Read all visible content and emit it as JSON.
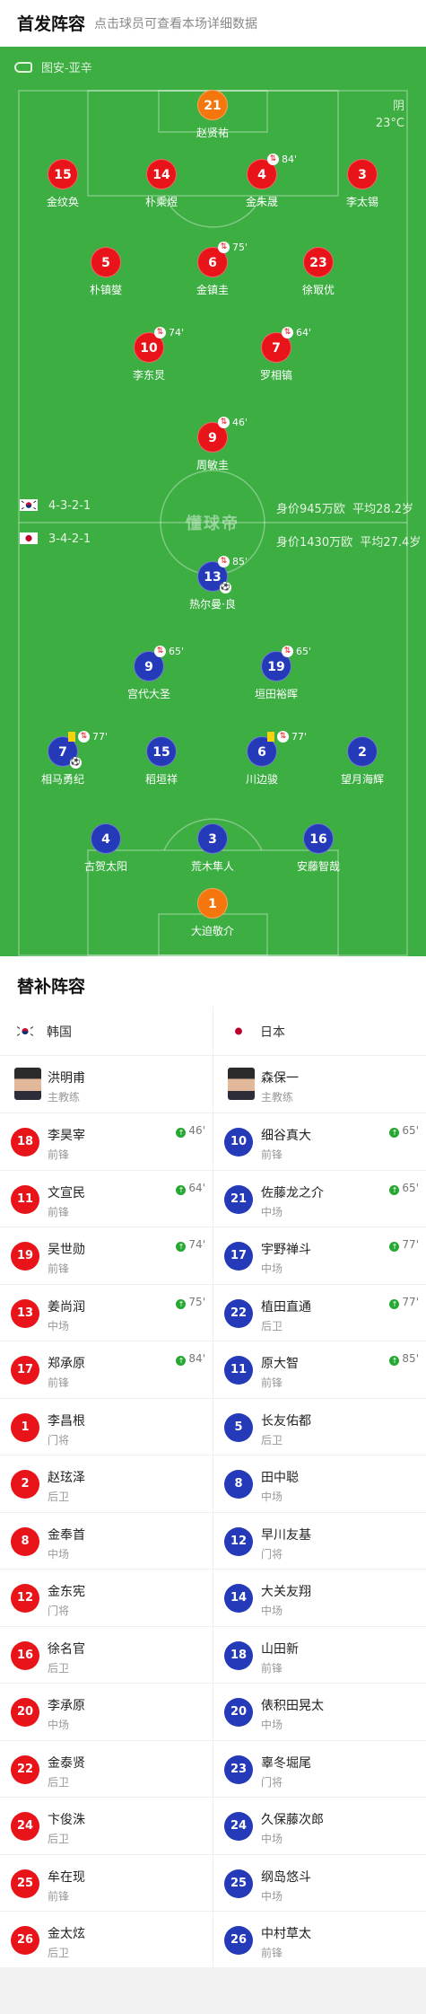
{
  "header": {
    "title": "首发阵容",
    "subtitle": "点击球员可查看本场详细数据"
  },
  "pitch": {
    "referee": "图安-亚辛",
    "weather": {
      "condition": "阴",
      "temperature": "23°C"
    },
    "watermark": "懂球帝",
    "home": {
      "formation": "4-3-2-1",
      "value": "身价945万欧",
      "avg_age": "平均28.2岁"
    },
    "away": {
      "formation": "3-4-2-1",
      "value": "身价1430万欧",
      "avg_age": "平均27.4岁"
    }
  },
  "home_players": [
    {
      "num": "21",
      "name": "赵贤祐",
      "gk": true
    },
    {
      "num": "15",
      "name": "金纹奂"
    },
    {
      "num": "14",
      "name": "朴乘煜"
    },
    {
      "num": "4",
      "name": "金朱晟",
      "sub": "84'"
    },
    {
      "num": "3",
      "name": "李太锡"
    },
    {
      "num": "5",
      "name": "朴镇燮"
    },
    {
      "num": "6",
      "name": "金镇圭",
      "sub": "75'"
    },
    {
      "num": "23",
      "name": "徐冣优"
    },
    {
      "num": "10",
      "name": "李东炅",
      "sub": "74'"
    },
    {
      "num": "7",
      "name": "罗相镐",
      "sub": "64'"
    },
    {
      "num": "9",
      "name": "周敏圭",
      "sub": "46'"
    }
  ],
  "away_players": [
    {
      "num": "13",
      "name": "热尔曼·良",
      "sub": "85'",
      "goal": true
    },
    {
      "num": "9",
      "name": "宫代大圣",
      "sub": "65'"
    },
    {
      "num": "19",
      "name": "垣田裕晖",
      "sub": "65'"
    },
    {
      "num": "7",
      "name": "相马勇纪",
      "sub": "77'",
      "yellow": true,
      "goal": true
    },
    {
      "num": "15",
      "name": "稻垣祥"
    },
    {
      "num": "6",
      "name": "川边骏",
      "sub": "77'",
      "yellow": true
    },
    {
      "num": "2",
      "name": "望月海辉"
    },
    {
      "num": "4",
      "name": "古贺太阳"
    },
    {
      "num": "3",
      "name": "荒木隼人"
    },
    {
      "num": "16",
      "name": "安藤智哉"
    },
    {
      "num": "1",
      "name": "大迫敬介",
      "gk": true
    }
  ],
  "subs_header": "替补阵容",
  "bench": {
    "home": {
      "team": "韩国",
      "coach": {
        "name": "洪明甫",
        "role": "主教练"
      },
      "players": [
        {
          "num": "18",
          "name": "李昊宰",
          "pos": "前锋",
          "in": "46'"
        },
        {
          "num": "11",
          "name": "文宣民",
          "pos": "前锋",
          "in": "64'"
        },
        {
          "num": "19",
          "name": "吴世勋",
          "pos": "前锋",
          "in": "74'"
        },
        {
          "num": "13",
          "name": "姜尚润",
          "pos": "中场",
          "in": "75'"
        },
        {
          "num": "17",
          "name": "郑承原",
          "pos": "前锋",
          "in": "84'"
        },
        {
          "num": "1",
          "name": "李昌根",
          "pos": "门将"
        },
        {
          "num": "2",
          "name": "赵玹泽",
          "pos": "后卫"
        },
        {
          "num": "8",
          "name": "金奉首",
          "pos": "中场"
        },
        {
          "num": "12",
          "name": "金东宪",
          "pos": "门将"
        },
        {
          "num": "16",
          "name": "徐名官",
          "pos": "后卫"
        },
        {
          "num": "20",
          "name": "李承原",
          "pos": "中场"
        },
        {
          "num": "22",
          "name": "金泰贤",
          "pos": "后卫"
        },
        {
          "num": "24",
          "name": "卞俊洙",
          "pos": "后卫"
        },
        {
          "num": "25",
          "name": "牟在现",
          "pos": "前锋"
        },
        {
          "num": "26",
          "name": "金太炫",
          "pos": "后卫"
        }
      ]
    },
    "away": {
      "team": "日本",
      "coach": {
        "name": "森保一",
        "role": "主教练"
      },
      "players": [
        {
          "num": "10",
          "name": "细谷真大",
          "pos": "前锋",
          "in": "65'"
        },
        {
          "num": "21",
          "name": "佐藤龙之介",
          "pos": "中场",
          "in": "65'"
        },
        {
          "num": "17",
          "name": "宇野禅斗",
          "pos": "中场",
          "in": "77'"
        },
        {
          "num": "22",
          "name": "植田直通",
          "pos": "后卫",
          "in": "77'"
        },
        {
          "num": "11",
          "name": "原大智",
          "pos": "前锋",
          "in": "85'"
        },
        {
          "num": "5",
          "name": "长友佑都",
          "pos": "后卫"
        },
        {
          "num": "8",
          "name": "田中聪",
          "pos": "中场"
        },
        {
          "num": "12",
          "name": "早川友基",
          "pos": "门将"
        },
        {
          "num": "14",
          "name": "大关友翔",
          "pos": "中场"
        },
        {
          "num": "18",
          "name": "山田新",
          "pos": "前锋"
        },
        {
          "num": "20",
          "name": "俵积田晃太",
          "pos": "中场"
        },
        {
          "num": "23",
          "name": "辜冬堀尾",
          "pos": "门将"
        },
        {
          "num": "24",
          "name": "久保藤次郎",
          "pos": "中场"
        },
        {
          "num": "25",
          "name": "纲岛悠斗",
          "pos": "中场"
        },
        {
          "num": "26",
          "name": "中村草太",
          "pos": "前锋"
        }
      ]
    }
  },
  "colors": {
    "pitch": "#3cae42",
    "home": "#e8141a",
    "away": "#253ab8",
    "keeper": "#f4760c",
    "sub_in": "#27a832"
  }
}
